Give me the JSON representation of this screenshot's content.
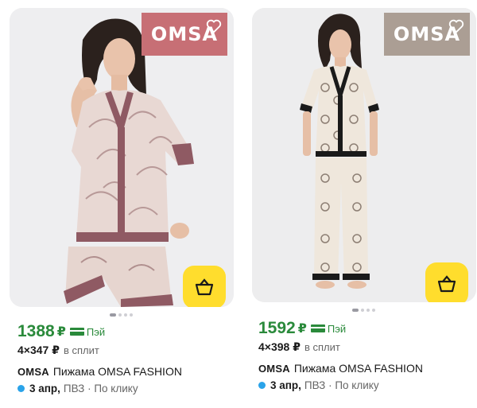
{
  "colors": {
    "price": "#2a8a3b",
    "cart": "#ffdd2d",
    "delivery_dot": "#2aa3e9",
    "brand_tag_1": "#c76f75",
    "brand_tag_2": "#ab9e94"
  },
  "products": [
    {
      "brand_logo": "OMSA",
      "price": "1388",
      "currency": "₽",
      "pay_label": "Пэй",
      "split_count": "4×347 ₽",
      "split_label": "в сплит",
      "brand": "OMSA",
      "title": "Пижама OMSA FASHION",
      "delivery_date": "3 апр,",
      "delivery_rest": "ПВЗ · По клику",
      "cart_icon": "basket-icon"
    },
    {
      "brand_logo": "OMSA",
      "price": "1592",
      "currency": "₽",
      "pay_label": "Пэй",
      "split_count": "4×398 ₽",
      "split_label": "в сплит",
      "brand": "OMSA",
      "title": "Пижама OMSA FASHION",
      "delivery_date": "3 апр,",
      "delivery_rest": "ПВЗ · По клику",
      "cart_icon": "basket-icon"
    }
  ]
}
